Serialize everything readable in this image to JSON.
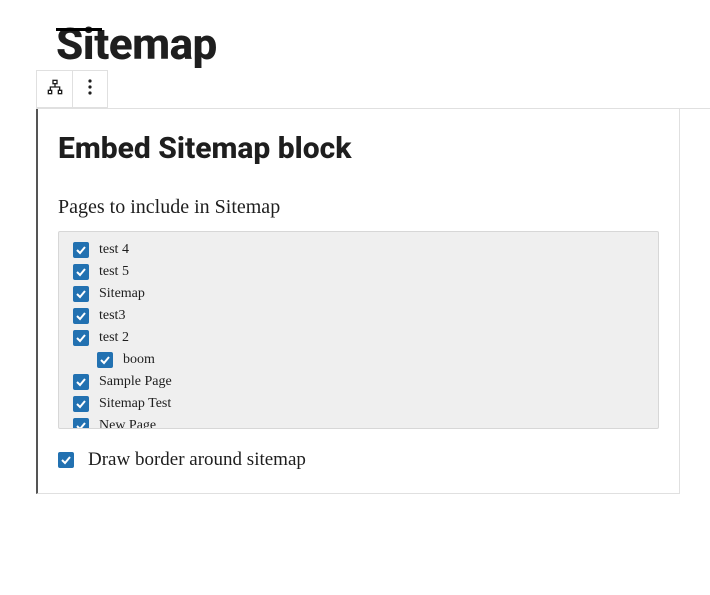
{
  "page": {
    "title": "Sitemap"
  },
  "block": {
    "title": "Embed Sitemap block",
    "section_label": "Pages to include in Sitemap",
    "pages": [
      {
        "label": "test 4",
        "checked": true,
        "indent": 0
      },
      {
        "label": "test 5",
        "checked": true,
        "indent": 0
      },
      {
        "label": "Sitemap",
        "checked": true,
        "indent": 0
      },
      {
        "label": "test3",
        "checked": true,
        "indent": 0
      },
      {
        "label": "test 2",
        "checked": true,
        "indent": 0
      },
      {
        "label": "boom",
        "checked": true,
        "indent": 1
      },
      {
        "label": "Sample Page",
        "checked": true,
        "indent": 0
      },
      {
        "label": "Sitemap Test",
        "checked": true,
        "indent": 0
      },
      {
        "label": "New Page",
        "checked": true,
        "indent": 0
      }
    ],
    "border_option": {
      "label": "Draw border around sitemap",
      "checked": true
    }
  }
}
